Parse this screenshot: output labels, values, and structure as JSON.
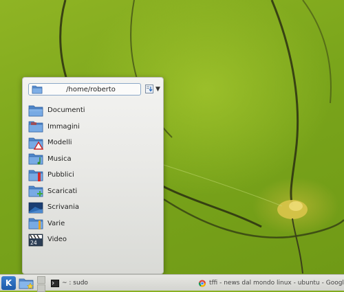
{
  "folder_view": {
    "path": "/home/roberto",
    "items": [
      {
        "label": "Documenti",
        "icon": "folder-icon"
      },
      {
        "label": "Immagini",
        "icon": "folder-images-icon"
      },
      {
        "label": "Modelli",
        "icon": "folder-templates-icon"
      },
      {
        "label": "Musica",
        "icon": "folder-music-icon"
      },
      {
        "label": "Pubblici",
        "icon": "folder-public-icon"
      },
      {
        "label": "Scaricati",
        "icon": "folder-downloads-icon"
      },
      {
        "label": "Scrivania",
        "icon": "desktop-icon"
      },
      {
        "label": "Varie",
        "icon": "folder-misc-icon"
      },
      {
        "label": "Video",
        "icon": "folder-video-icon"
      }
    ]
  },
  "taskbar": {
    "kmenu_glyph": "K",
    "tasks": [
      {
        "label": "~ : sudo",
        "icon": "terminal-icon"
      },
      {
        "label": "tffi - news dal mondo linux - ubuntu - Google Ch",
        "icon": "chrome-icon"
      }
    ]
  },
  "colors": {
    "folder_blue": "#5a8fd0",
    "accent": "#3a7fd0",
    "wallpaper_green": "#7aa51b"
  }
}
